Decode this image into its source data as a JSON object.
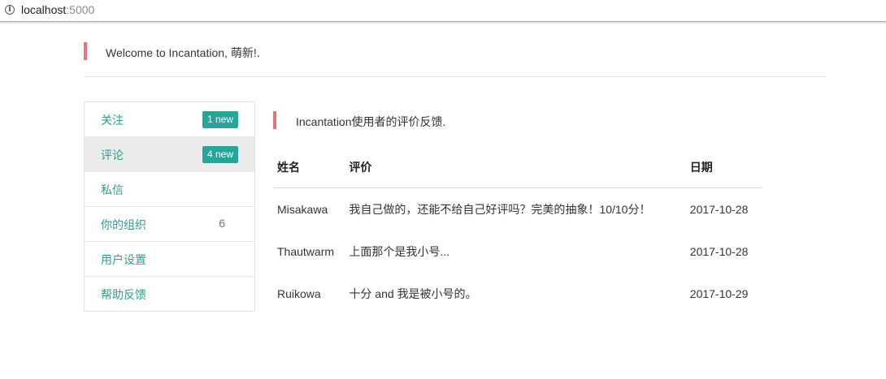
{
  "browser": {
    "url_host": "localhost",
    "url_port": ":5000"
  },
  "welcome": {
    "text": "Welcome to Incantation, 萌新!."
  },
  "menu": {
    "items": [
      {
        "label": "关注",
        "badge": "1 new"
      },
      {
        "label": "评论",
        "badge": "4 new",
        "active": true
      },
      {
        "label": "私信"
      },
      {
        "label": "你的组织",
        "count": "6"
      },
      {
        "label": "用户设置"
      },
      {
        "label": "帮助反馈"
      }
    ]
  },
  "content": {
    "heading": "Incantation使用者的评价反馈.",
    "table": {
      "headers": [
        "姓名",
        "评价",
        "日期"
      ],
      "rows": [
        {
          "name": "Misakawa",
          "comment": "我自己做的，还能不给自己好评吗？完美的抽象！10/10分！",
          "date": "2017-10-28"
        },
        {
          "name": "Thautwarm",
          "comment": "上面那个是我小号...",
          "date": "2017-10-28"
        },
        {
          "name": "Ruikowa",
          "comment": "十分 and 我是被小号的。",
          "date": "2017-10-29"
        }
      ]
    }
  },
  "colors": {
    "accent_red": "#e8717b",
    "accent_teal": "#26a59a",
    "link_teal": "#2e9e8f"
  }
}
